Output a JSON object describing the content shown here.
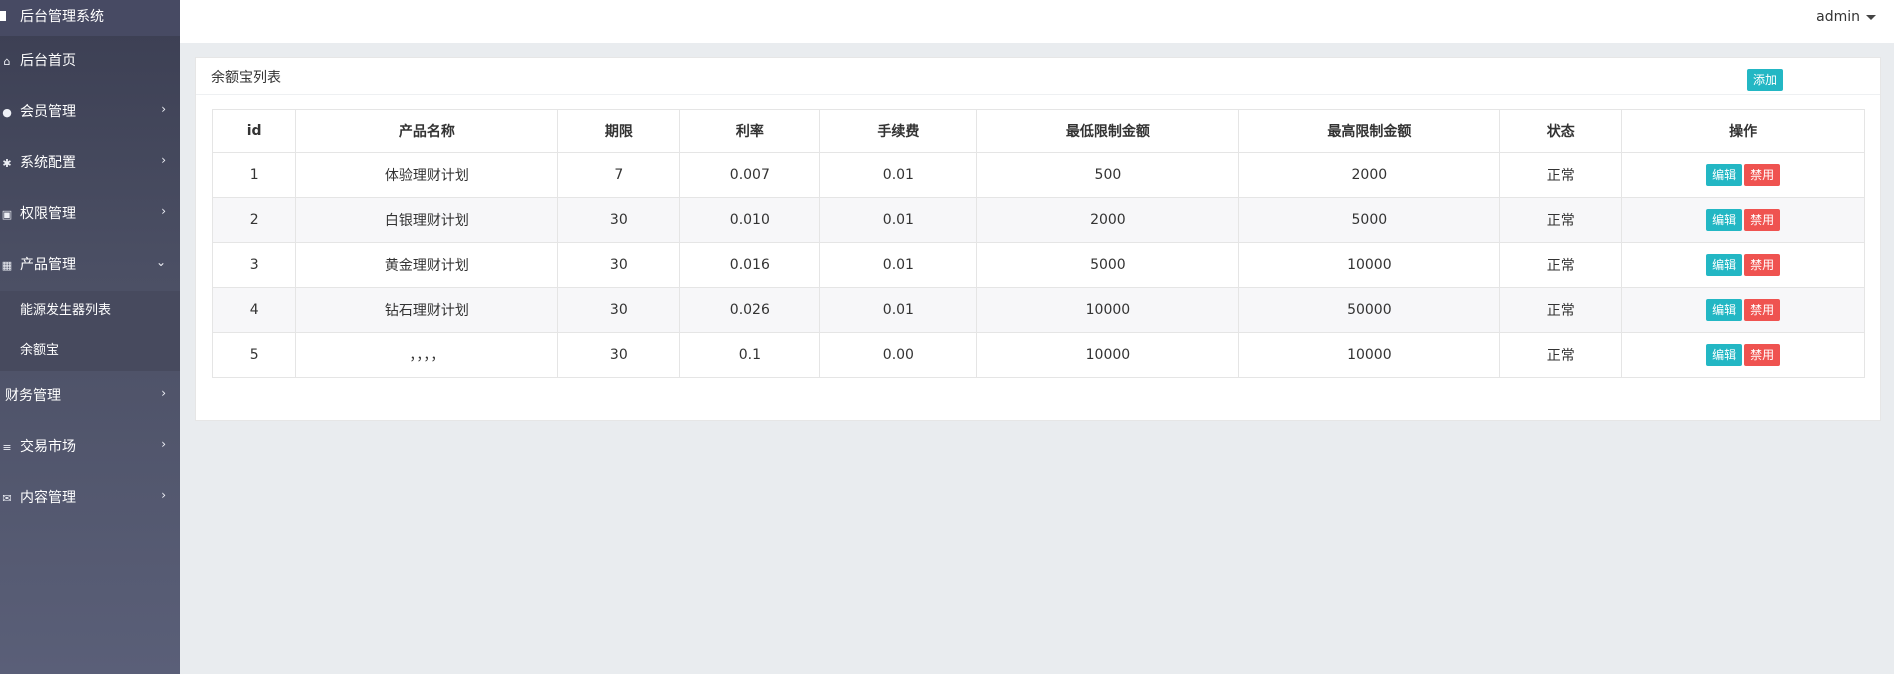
{
  "sidebar": {
    "brand": "后台管理系统",
    "items": [
      {
        "label": "后台首页",
        "icon": "home-icon",
        "glyph": "⌂",
        "chev": ""
      },
      {
        "label": "会员管理",
        "icon": "user-icon",
        "glyph": "●",
        "chev": "›"
      },
      {
        "label": "系统配置",
        "icon": "cogs-icon",
        "glyph": "✱",
        "chev": "›"
      },
      {
        "label": "权限管理",
        "icon": "id-card-icon",
        "glyph": "▣",
        "chev": "›"
      },
      {
        "label": "产品管理",
        "icon": "windows-icon",
        "glyph": "▦",
        "chev": "⌄"
      }
    ],
    "sub_items": [
      "能源发生器列表",
      "余额宝"
    ],
    "items_after": [
      {
        "label": "财务管理",
        "icon": "",
        "glyph": "",
        "chev": "›"
      },
      {
        "label": "交易市场",
        "icon": "list-icon",
        "glyph": "≡",
        "chev": "›"
      },
      {
        "label": "内容管理",
        "icon": "envelope-icon",
        "glyph": "✉",
        "chev": "›"
      }
    ]
  },
  "header": {
    "user": "admin"
  },
  "panel": {
    "title": "余额宝列表",
    "add_label": "添加",
    "columns": [
      "id",
      "产品名称",
      "期限",
      "利率",
      "手续费",
      "最低限制金额",
      "最高限制金额",
      "状态",
      "操作"
    ],
    "rows": [
      [
        "1",
        "体验理财计划",
        "7",
        "0.007",
        "0.01",
        "500",
        "2000",
        "正常"
      ],
      [
        "2",
        "白银理财计划",
        "30",
        "0.010",
        "0.01",
        "2000",
        "5000",
        "正常"
      ],
      [
        "3",
        "黄金理财计划",
        "30",
        "0.016",
        "0.01",
        "5000",
        "10000",
        "正常"
      ],
      [
        "4",
        "钻石理财计划",
        "30",
        "0.026",
        "0.01",
        "10000",
        "50000",
        "正常"
      ],
      [
        "5",
        "，，，，",
        "30",
        "0.1",
        "0.00",
        "10000",
        "10000",
        "正常"
      ]
    ],
    "edit_label": "编辑",
    "ban_label": "禁用"
  },
  "colors": {
    "sidebar_bg": "#474a63",
    "accent": "#23b7c4",
    "danger": "#ef5350",
    "page_bg": "#e9ecef"
  }
}
